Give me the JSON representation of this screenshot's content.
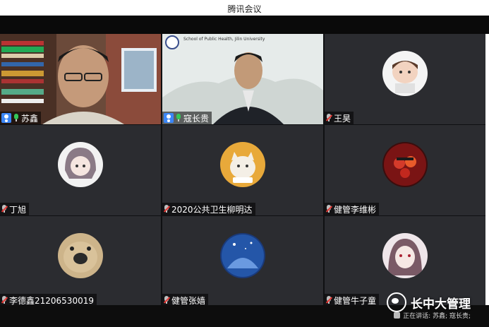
{
  "app": {
    "title": "腾讯会议"
  },
  "participants": [
    {
      "name": "苏鑫",
      "host": true,
      "mic": "on",
      "video": true,
      "active": true
    },
    {
      "name": "寇长贵",
      "host": true,
      "mic": "on",
      "video": true,
      "active": false
    },
    {
      "name": "王昊",
      "host": false,
      "mic": "off",
      "video": false,
      "active": false
    },
    {
      "name": "丁旭",
      "host": false,
      "mic": "off",
      "video": false,
      "active": false
    },
    {
      "name": "2020公共卫生柳明达",
      "host": false,
      "mic": "off",
      "video": false,
      "active": false
    },
    {
      "name": "健管李维彬",
      "host": false,
      "mic": "off",
      "video": false,
      "active": false
    },
    {
      "name": "李德鑫21206530019",
      "host": false,
      "mic": "off",
      "video": false,
      "active": false
    },
    {
      "name": "健管张嫱",
      "host": false,
      "mic": "off",
      "video": false,
      "active": false
    },
    {
      "name": "健管牛子童",
      "host": false,
      "mic": "off",
      "video": false,
      "active": false
    }
  ],
  "slide_logo": {
    "school_name_en": "School of Public Health, Jilin University"
  },
  "status": {
    "speaking": "正在讲话: 苏鑫; 寇长贵;"
  },
  "watermark": {
    "text": "长中大管理"
  },
  "colors": {
    "active_border": "#28b14c",
    "host_badge": "#3b86f7",
    "mic_on": "#34c759",
    "tile_bg": "#2b2c30"
  }
}
